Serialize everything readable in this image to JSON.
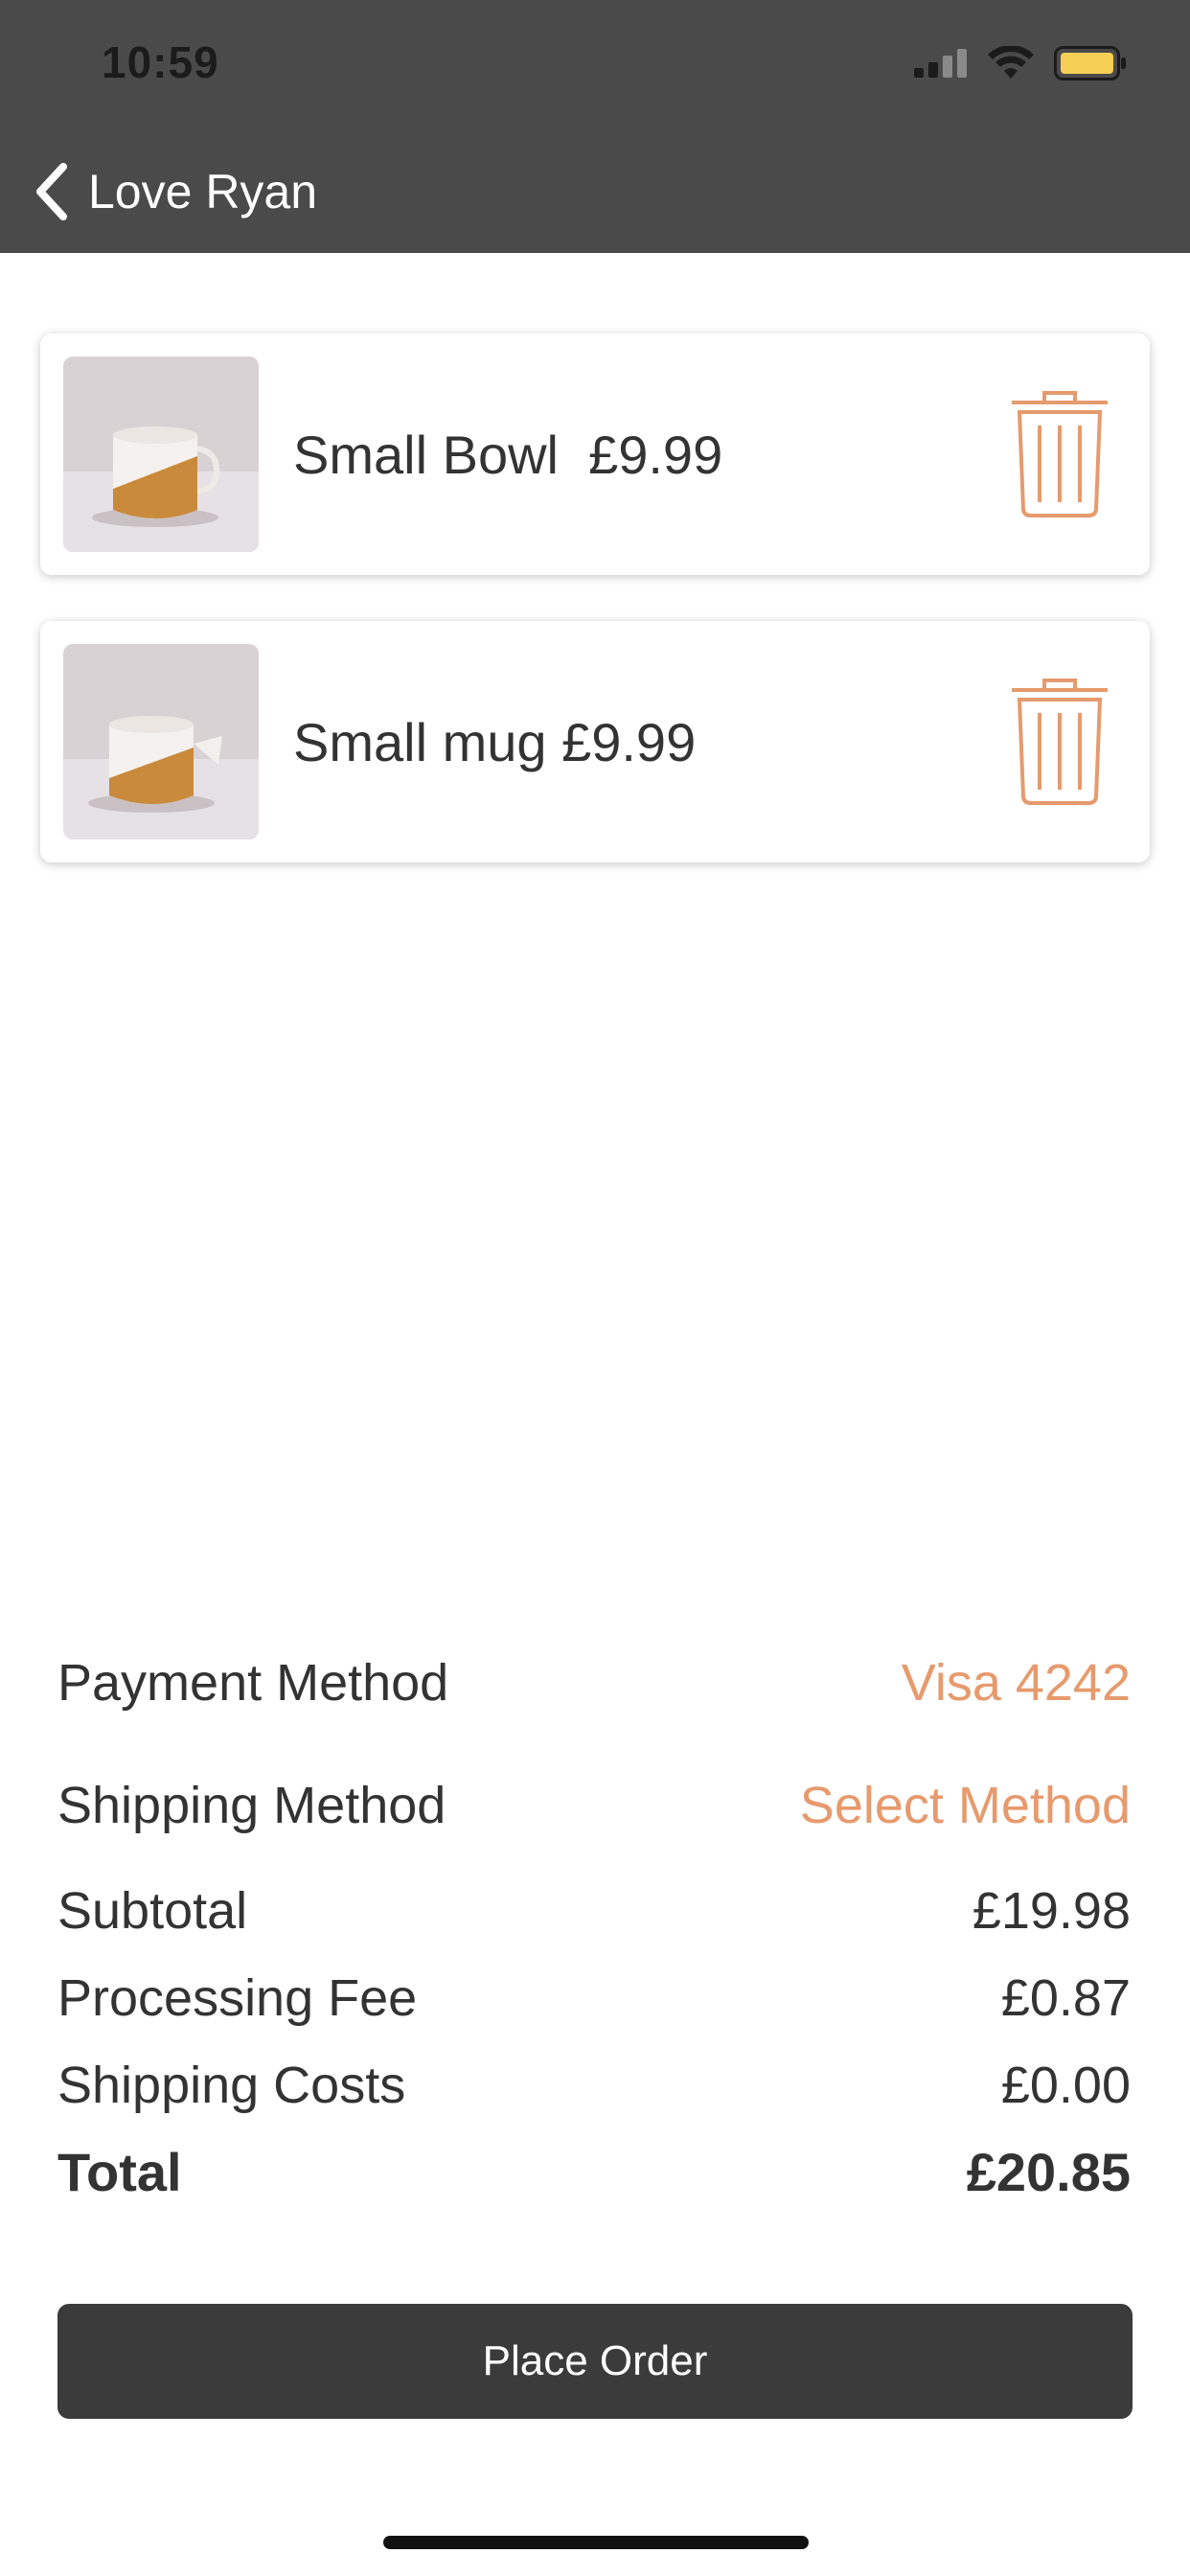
{
  "status_bar": {
    "time": "10:59",
    "battery_color": "#f5cf55"
  },
  "nav": {
    "back_label": "Love Ryan",
    "back_icon": "chevron-left-icon"
  },
  "cart_items": [
    {
      "name": "Small Bowl",
      "price": "£9.99",
      "text": "Small Bowl  £9.99",
      "delete_icon": "trash-icon"
    },
    {
      "name": "Small mug",
      "price": "£9.99",
      "text": "Small mug £9.99",
      "delete_icon": "trash-icon"
    }
  ],
  "summary": {
    "payment_method": {
      "label": "Payment Method",
      "value": "Visa 4242"
    },
    "shipping_method": {
      "label": "Shipping Method",
      "value": "Select Method"
    },
    "subtotal": {
      "label": "Subtotal",
      "value": "£19.98"
    },
    "processing_fee": {
      "label": "Processing Fee",
      "value": "£0.87"
    },
    "shipping_costs": {
      "label": "Shipping Costs",
      "value": "£0.00"
    },
    "total": {
      "label": "Total",
      "value": "£20.85"
    }
  },
  "actions": {
    "place_order": "Place Order"
  },
  "colors": {
    "header": "#4a4a4a",
    "accent": "#e69a6d",
    "button": "#3b3b3b"
  }
}
